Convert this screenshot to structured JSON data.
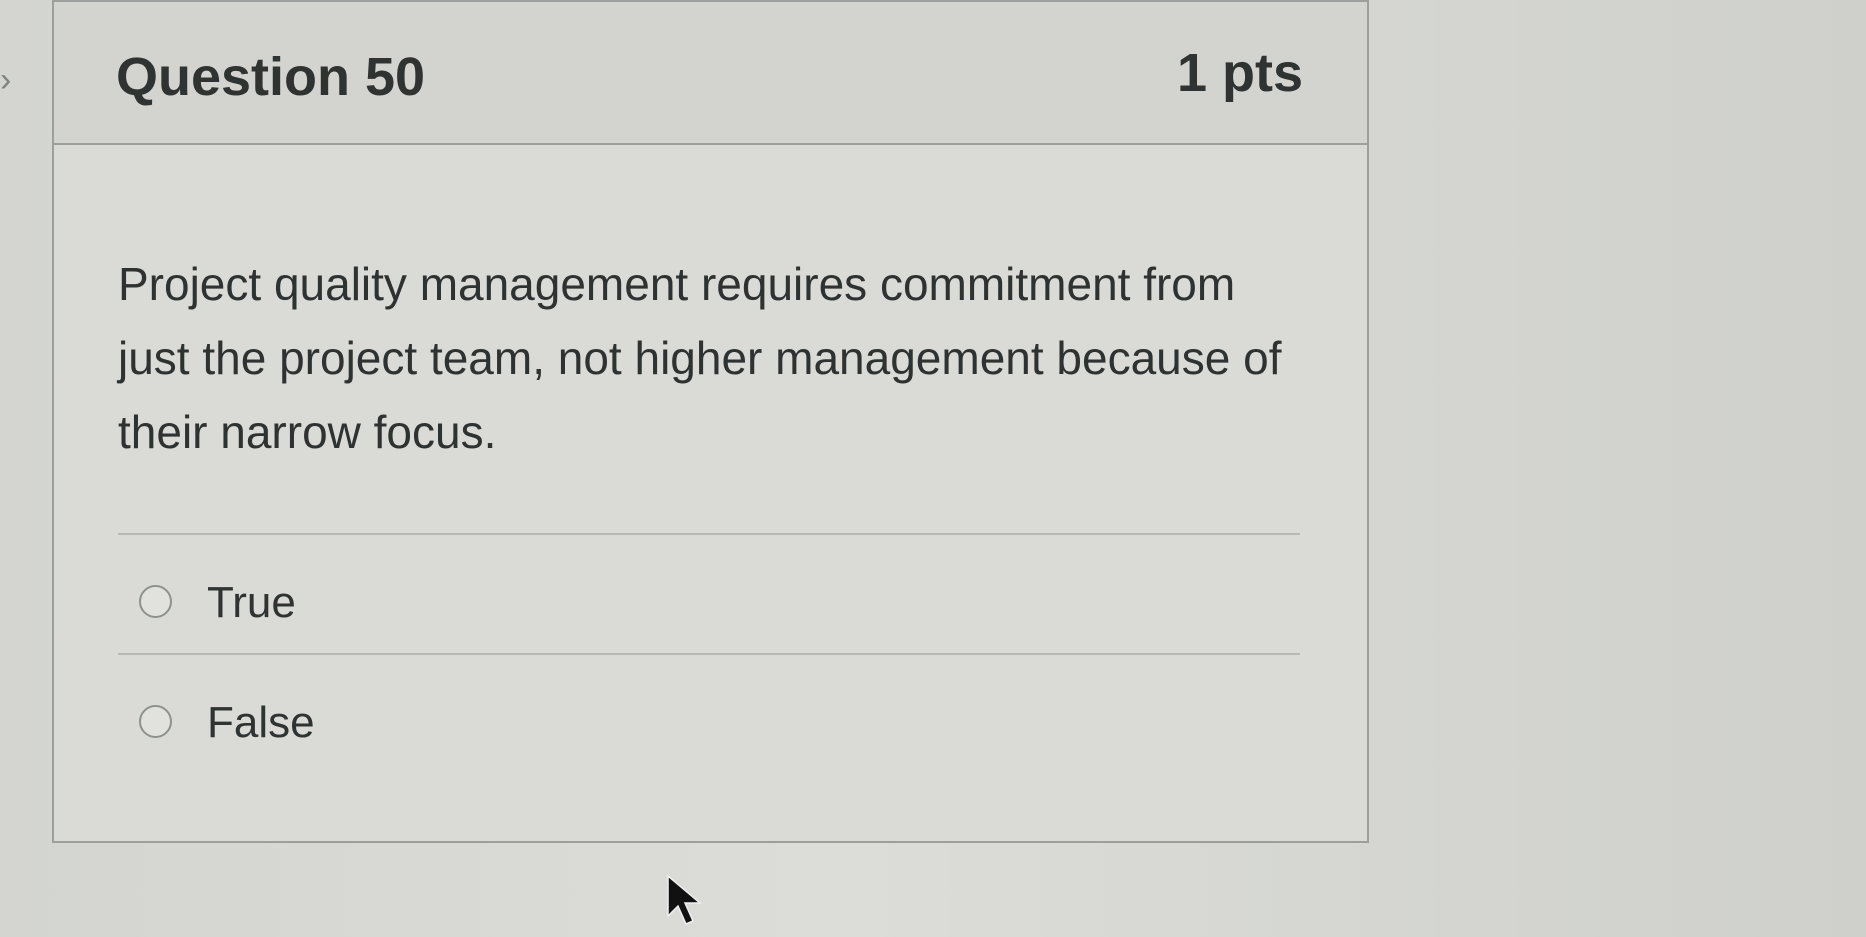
{
  "question": {
    "title": "Question 50",
    "points": "1 pts",
    "text": "Project quality management requires commitment from just the project team, not higher management because of their narrow focus."
  },
  "options": [
    {
      "label": "True"
    },
    {
      "label": "False"
    }
  ],
  "icons": {
    "nav": "chevron-right-icon",
    "cursor": "mouse-pointer-icon"
  }
}
